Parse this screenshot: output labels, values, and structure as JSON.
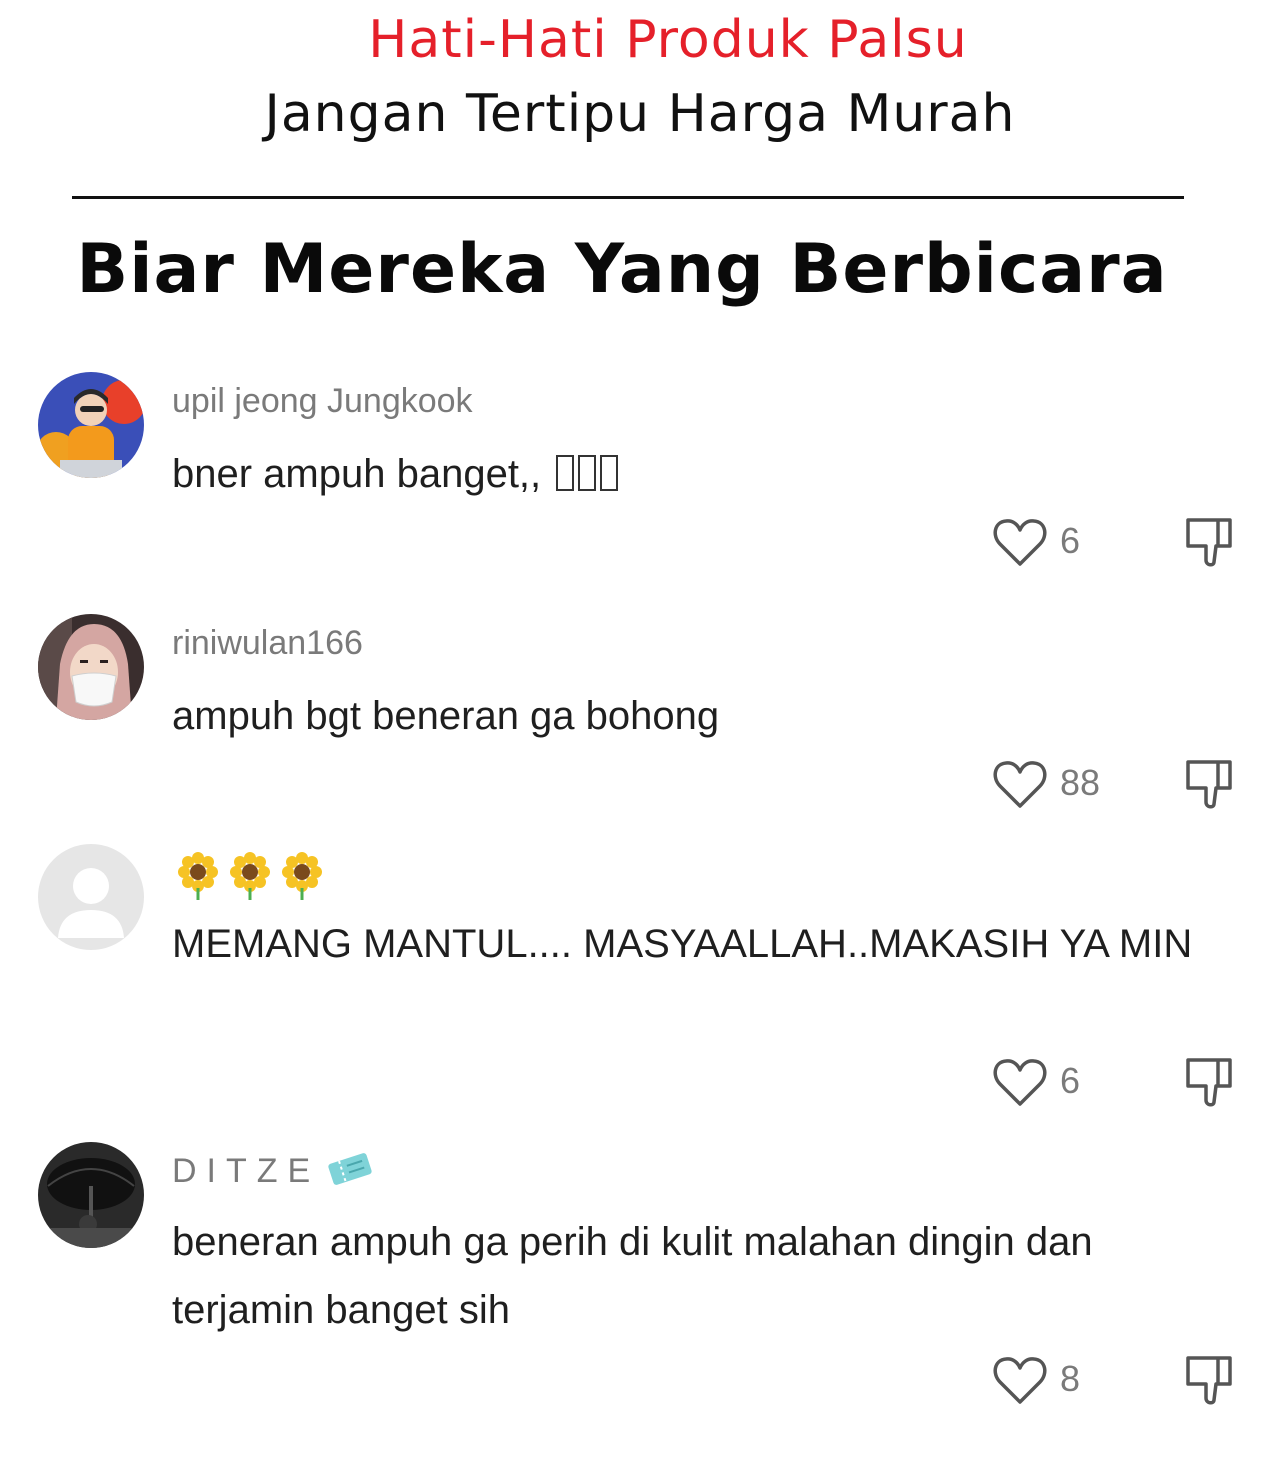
{
  "header": {
    "warning_title": "Hati-Hati Produk Palsu",
    "warning_subtitle": "Jangan Tertipu Harga Murah",
    "section_title": "Biar Mereka Yang Berbicara"
  },
  "colors": {
    "warning_red": "#e5202a",
    "username_gray": "#7a7a7a",
    "text_dark": "#1f1f1f"
  },
  "comments": [
    {
      "username": "upil jeong Jungkook",
      "text": "bner ampuh banget,,",
      "likes": "6",
      "avatar_icon": "user-photo-avatar"
    },
    {
      "username": "riniwulan166",
      "text": "ampuh bgt beneran ga bohong",
      "likes": "88",
      "avatar_icon": "user-photo-avatar"
    },
    {
      "username": "",
      "username_icon": "sunflower-emoji",
      "text": "MEMANG MANTUL.... MASYAALLAH..MAKASIH YA MIN",
      "likes": "6",
      "avatar_icon": "default-avatar"
    },
    {
      "username": "DITZE",
      "username_icon": "ticket-emoji",
      "text": "beneran ampuh ga perih di kulit malahan dingin dan terjamin banget sih",
      "likes": "8",
      "avatar_icon": "user-photo-avatar"
    }
  ]
}
